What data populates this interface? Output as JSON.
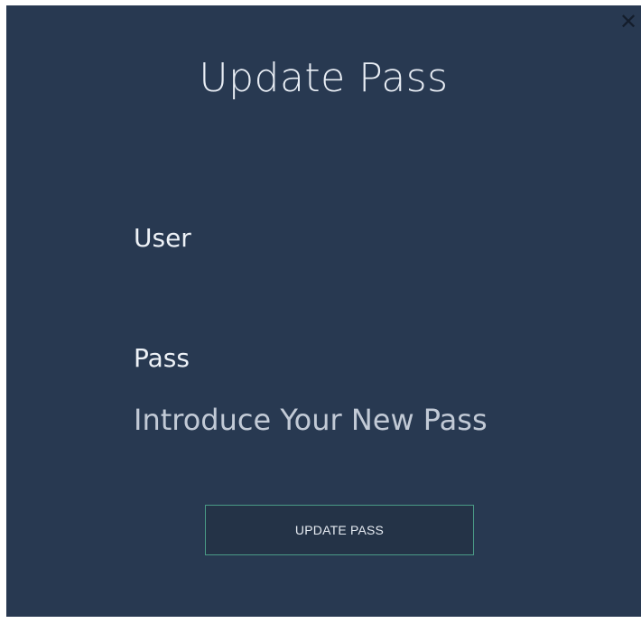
{
  "dialog": {
    "title": "Update Pass",
    "close_glyph": "✕",
    "close_icon": "close-icon"
  },
  "form": {
    "user_label": "User",
    "user_value": "",
    "pass_label": "Pass",
    "pass_placeholder": "Introduce Your New Pass",
    "pass_value": "",
    "submit_label": "UPDATE PASS"
  },
  "colors": {
    "background": "#283951",
    "button_border": "#4a9a86",
    "text": "#e9eef5"
  }
}
